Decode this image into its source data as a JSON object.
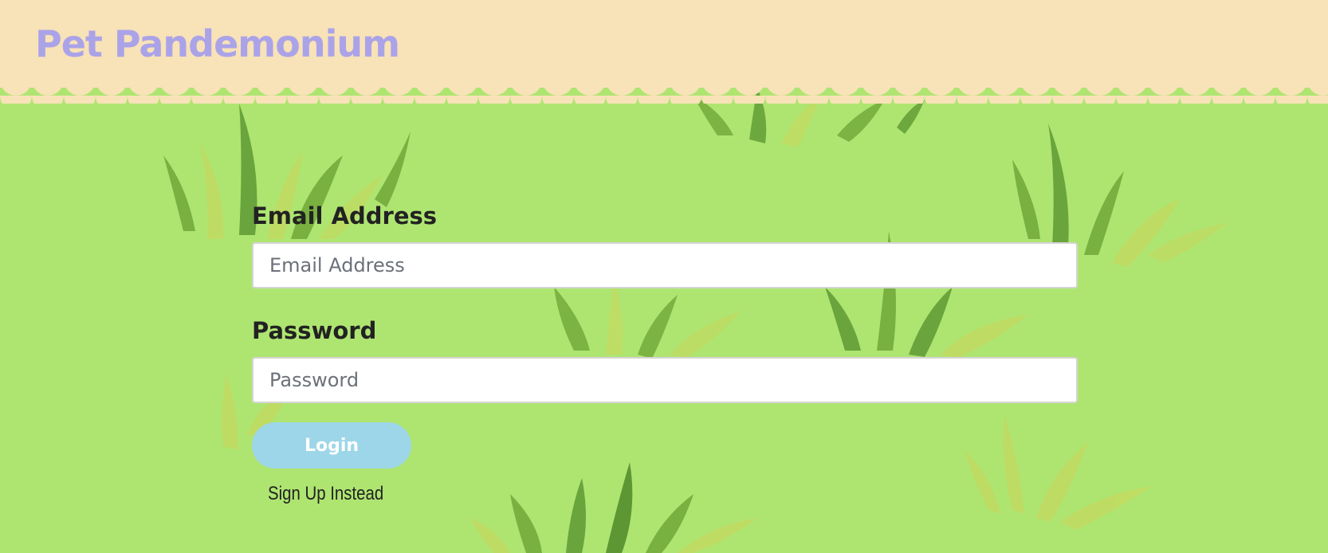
{
  "brand": {
    "title": "Pet Pandemonium"
  },
  "colors": {
    "header_bg": "#f8e2b7",
    "grass_bg": "#aee571",
    "brand_text": "#aba3e8",
    "button_bg": "#9dd6e8"
  },
  "login_form": {
    "email": {
      "label": "Email Address",
      "placeholder": "Email Address",
      "value": ""
    },
    "password": {
      "label": "Password",
      "placeholder": "Password",
      "value": ""
    },
    "login_label": "Login",
    "signup_label": "Sign Up Instead"
  }
}
